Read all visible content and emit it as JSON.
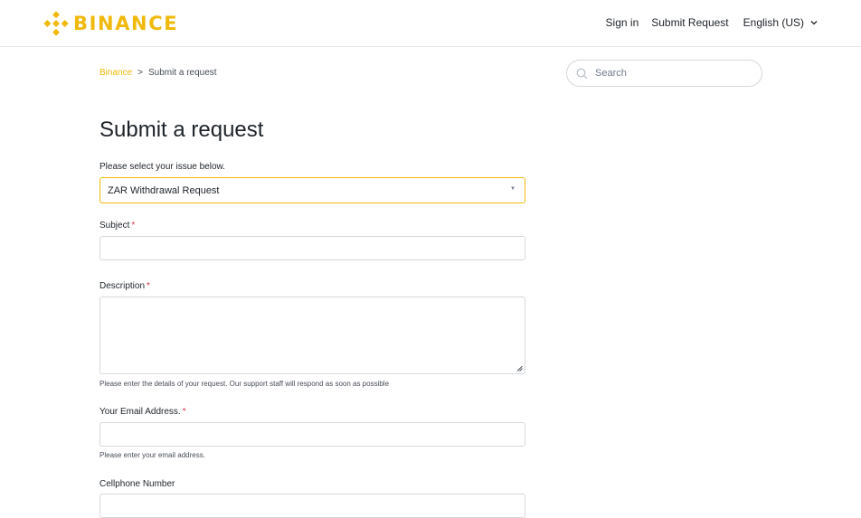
{
  "brand": {
    "name": "BINANCE",
    "color": "#f0b90b",
    "logo_icon": "binance-diamond-logo"
  },
  "nav": {
    "sign_in": "Sign in",
    "submit_request": "Submit Request",
    "language": "English (US)"
  },
  "breadcrumb": {
    "home": "Binance",
    "separator": ">",
    "current": "Submit a request"
  },
  "search": {
    "placeholder": "Search"
  },
  "form": {
    "title": "Submit a request",
    "issue": {
      "label": "Please select your issue below.",
      "selected": "ZAR Withdrawal Request"
    },
    "subject": {
      "label": "Subject",
      "required_mark": "*",
      "value": ""
    },
    "description": {
      "label": "Description",
      "required_mark": "*",
      "value": "",
      "hint": "Please enter the details of your request. Our support staff will respond as soon as possible"
    },
    "email": {
      "label": "Your Email Address.",
      "required_mark": "*",
      "value": "",
      "hint": "Please enter your email address."
    },
    "cellphone": {
      "label": "Cellphone Number"
    }
  }
}
